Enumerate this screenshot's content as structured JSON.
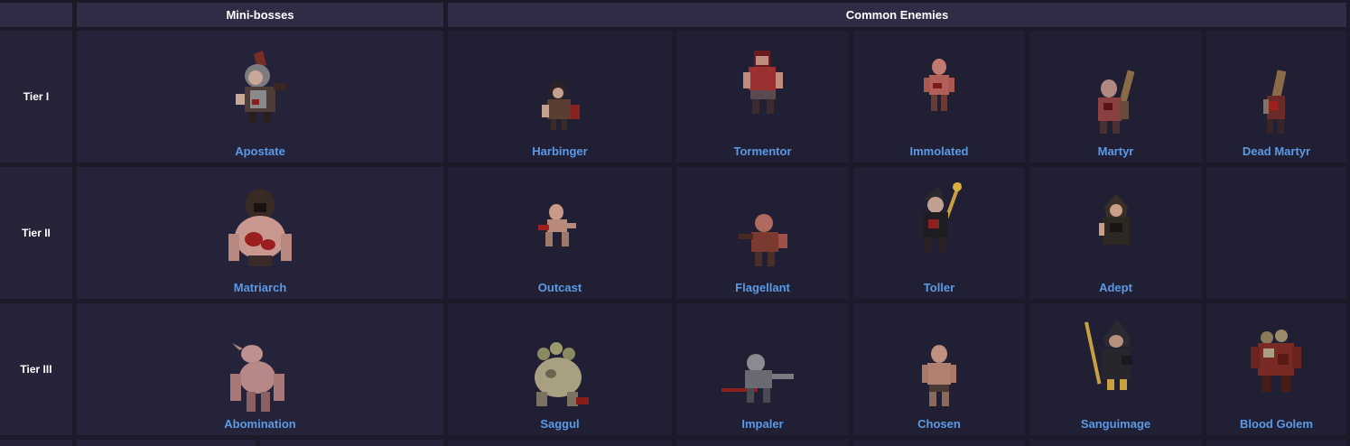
{
  "headers": {
    "minibosses": "Mini-bosses",
    "common": "Common Enemies"
  },
  "tiers": [
    {
      "label": "Tier I",
      "miniboss": {
        "name": "Apostate",
        "icon": "apostate-sprite-icon"
      },
      "enemies": [
        {
          "name": "Harbinger",
          "icon": "harbinger-sprite-icon"
        },
        {
          "name": "Tormentor",
          "icon": "tormentor-sprite-icon"
        },
        {
          "name": "Immolated",
          "icon": "immolated-sprite-icon"
        },
        {
          "name": "Martyr",
          "icon": "martyr-sprite-icon"
        },
        {
          "name": "Dead Martyr",
          "icon": "dead-martyr-sprite-icon"
        }
      ]
    },
    {
      "label": "Tier II",
      "miniboss": {
        "name": "Matriarch",
        "icon": "matriarch-sprite-icon"
      },
      "enemies": [
        {
          "name": "Outcast",
          "icon": "outcast-sprite-icon"
        },
        {
          "name": "Flagellant",
          "icon": "flagellant-sprite-icon"
        },
        {
          "name": "Toller",
          "icon": "toller-sprite-icon"
        },
        {
          "name": "Adept",
          "icon": "adept-sprite-icon"
        },
        {
          "name": "",
          "icon": ""
        }
      ]
    },
    {
      "label": "Tier III",
      "miniboss": {
        "name": "Abomination",
        "icon": "abomination-sprite-icon"
      },
      "enemies": [
        {
          "name": "Saggul",
          "icon": "saggul-sprite-icon"
        },
        {
          "name": "Impaler",
          "icon": "impaler-sprite-icon"
        },
        {
          "name": "Chosen",
          "icon": "chosen-sprite-icon"
        },
        {
          "name": "Sanguimage",
          "icon": "sanguimage-sprite-icon"
        },
        {
          "name": "Blood Golem",
          "icon": "blood-golem-sprite-icon"
        }
      ]
    }
  ]
}
